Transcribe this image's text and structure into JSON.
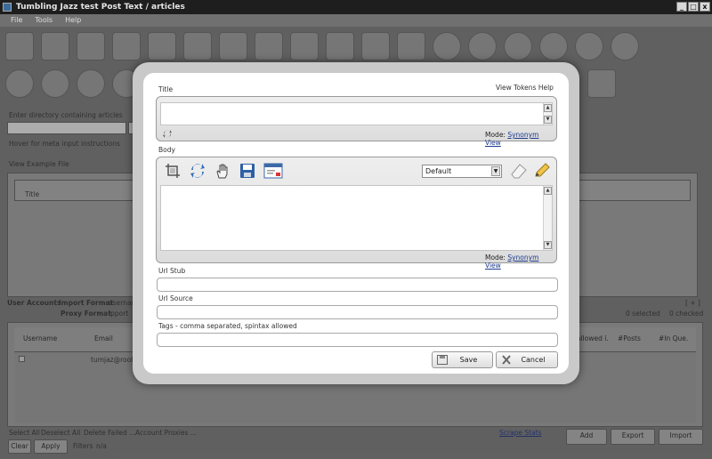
{
  "window": {
    "title": "Tumbling Jazz test Post Text / articles",
    "minimize": "_",
    "maximize": "□",
    "close": "x"
  },
  "menu": [
    "File",
    "Tools",
    "Help"
  ],
  "background": {
    "dir_label": "Enter directory containing articles",
    "hover_hint": "Hover for meta input instructions",
    "view_example": "View Example File",
    "title_col": "Title",
    "user_accounts": "User Accounts",
    "import_format": "Import Format",
    "import_format_value": "username",
    "proxy_format": "Proxy Format",
    "proxy_format_value": "ipport",
    "expand": "[ + ]",
    "selected": "0 selected",
    "checked": "0 checked",
    "columns": [
      "Username",
      "Email",
      "allowed i.",
      "#Posts",
      "#In Que."
    ],
    "row_email": "tumjaz@rooljazz",
    "footer_links": [
      "Select All",
      "Deselect All",
      "Delete Failed ...",
      "Account Proxies ..."
    ],
    "clear": "Clear",
    "apply": "Apply",
    "filters": "Filters",
    "filters_value": "n/a",
    "scrape_stats": "Scrape Stats",
    "add": "Add",
    "export": "Export",
    "import": "Import"
  },
  "dialog": {
    "title_label": "Title",
    "view_tokens_help": "View Tokens Help",
    "mode_label": "Mode:",
    "mode_value": "Synonym View",
    "body_label": "Body",
    "format_selected": "Default",
    "url_stub_label": "Url Stub",
    "url_source_label": "Url Source",
    "tags_label": "Tags - comma separated, spintax allowed",
    "save": "Save",
    "cancel": "Cancel",
    "icons": [
      "crop-icon",
      "refresh-icon",
      "hand-icon",
      "save-disk-icon",
      "window-icon",
      "eraser-icon",
      "pencil-icon"
    ]
  }
}
